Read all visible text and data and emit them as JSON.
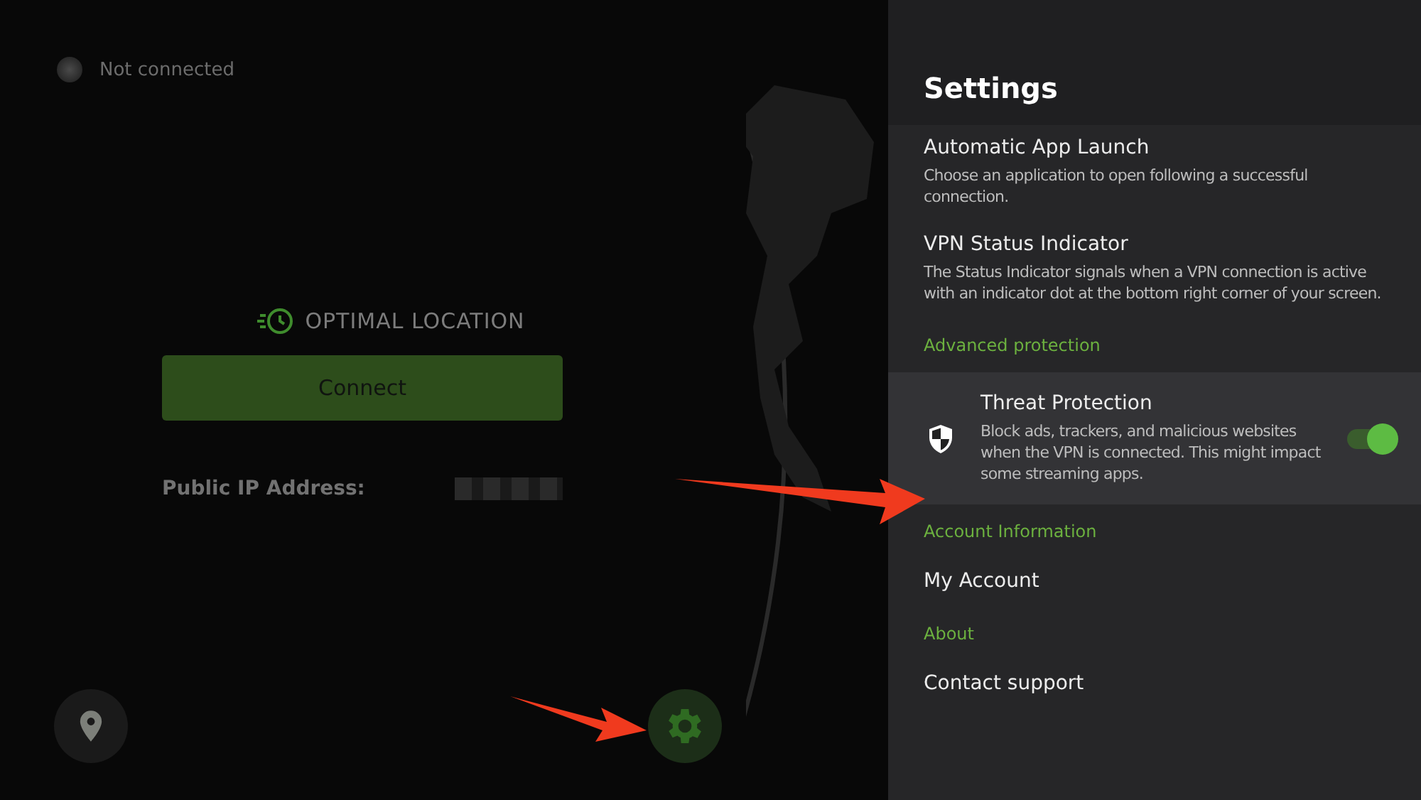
{
  "status": {
    "text": "Not connected",
    "connected": false
  },
  "location": {
    "label": "OPTIMAL LOCATION"
  },
  "connect_button": "Connect",
  "ip": {
    "label": "Public IP Address:"
  },
  "settings": {
    "title": "Settings",
    "items": [
      {
        "kind": "item",
        "title": "Automatic App Launch",
        "description": "Choose an application to open following a successful connection."
      },
      {
        "kind": "item",
        "title": "VPN Status Indicator",
        "description": "The Status Indicator signals when a VPN connection is active with an indicator dot at the bottom right corner of your screen."
      },
      {
        "kind": "section",
        "title": "Advanced protection"
      },
      {
        "kind": "toggle",
        "title": "Threat Protection",
        "description": "Block ads, trackers, and malicious websites when the VPN is connected. This might impact some streaming apps.",
        "on": true,
        "selected": true
      },
      {
        "kind": "section",
        "title": "Account Information"
      },
      {
        "kind": "item",
        "title": "My Account"
      },
      {
        "kind": "section",
        "title": "About"
      },
      {
        "kind": "item",
        "title": "Contact support"
      }
    ]
  }
}
